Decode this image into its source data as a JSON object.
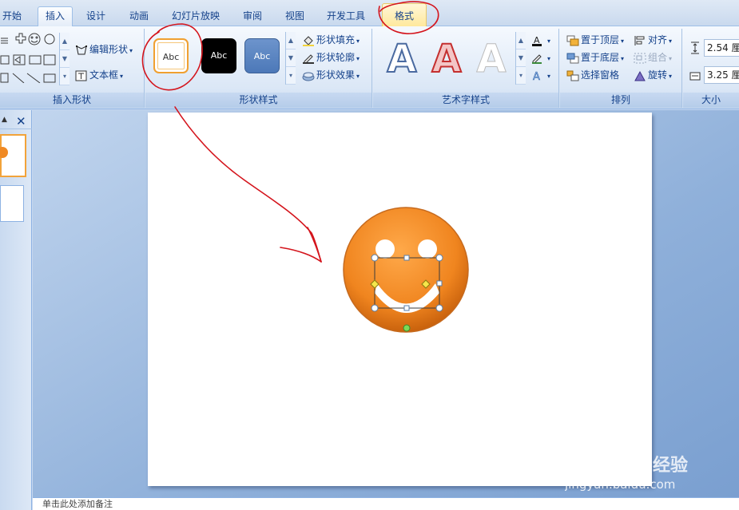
{
  "tabs": [
    "开始",
    "插入",
    "设计",
    "动画",
    "幻灯片放映",
    "审阅",
    "视图",
    "开发工具",
    "格式"
  ],
  "active_tab": "插入",
  "context_tab": "格式",
  "groups": {
    "insert_shapes": {
      "title": "插入形状",
      "edit_shape_label": "编辑形状",
      "textbox_label": "文本框"
    },
    "shape_styles": {
      "title": "形状样式",
      "thumb_label": "Abc",
      "fill_label": "形状填充",
      "outline_label": "形状轮廓",
      "effects_label": "形状效果"
    },
    "wordart_styles": {
      "title": "艺术字样式",
      "letter": "A"
    },
    "arrange": {
      "title": "排列",
      "bring_front": "置于顶层",
      "send_back": "置于底层",
      "selection_pane": "选择窗格",
      "align": "对齐",
      "group": "组合",
      "rotate": "旋转"
    },
    "size": {
      "title": "大小",
      "height_value": "2.54 厘",
      "width_value": "3.25 厘"
    }
  },
  "notes_text": "单击此处添加备注",
  "watermark": {
    "brand": "Baidu经验",
    "url": "jingyan.baidu.com"
  },
  "colors": {
    "annotation_red": "#d4141c",
    "smiley_orange": "#f08a24"
  }
}
